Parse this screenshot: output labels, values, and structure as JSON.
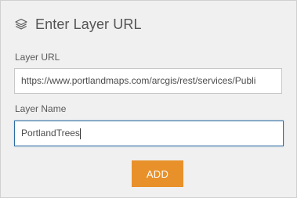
{
  "header": {
    "icon": "layers-icon",
    "title": "Enter Layer URL"
  },
  "form": {
    "url_label": "Layer URL",
    "url_value": "https://www.portlandmaps.com/arcgis/rest/services/Publi",
    "name_label": "Layer Name",
    "name_value": "PortlandTrees"
  },
  "actions": {
    "add_label": "ADD"
  },
  "colors": {
    "panel_bg": "#f0f0f0",
    "accent": "#e8912b",
    "focus_border": "#2e6da4"
  }
}
